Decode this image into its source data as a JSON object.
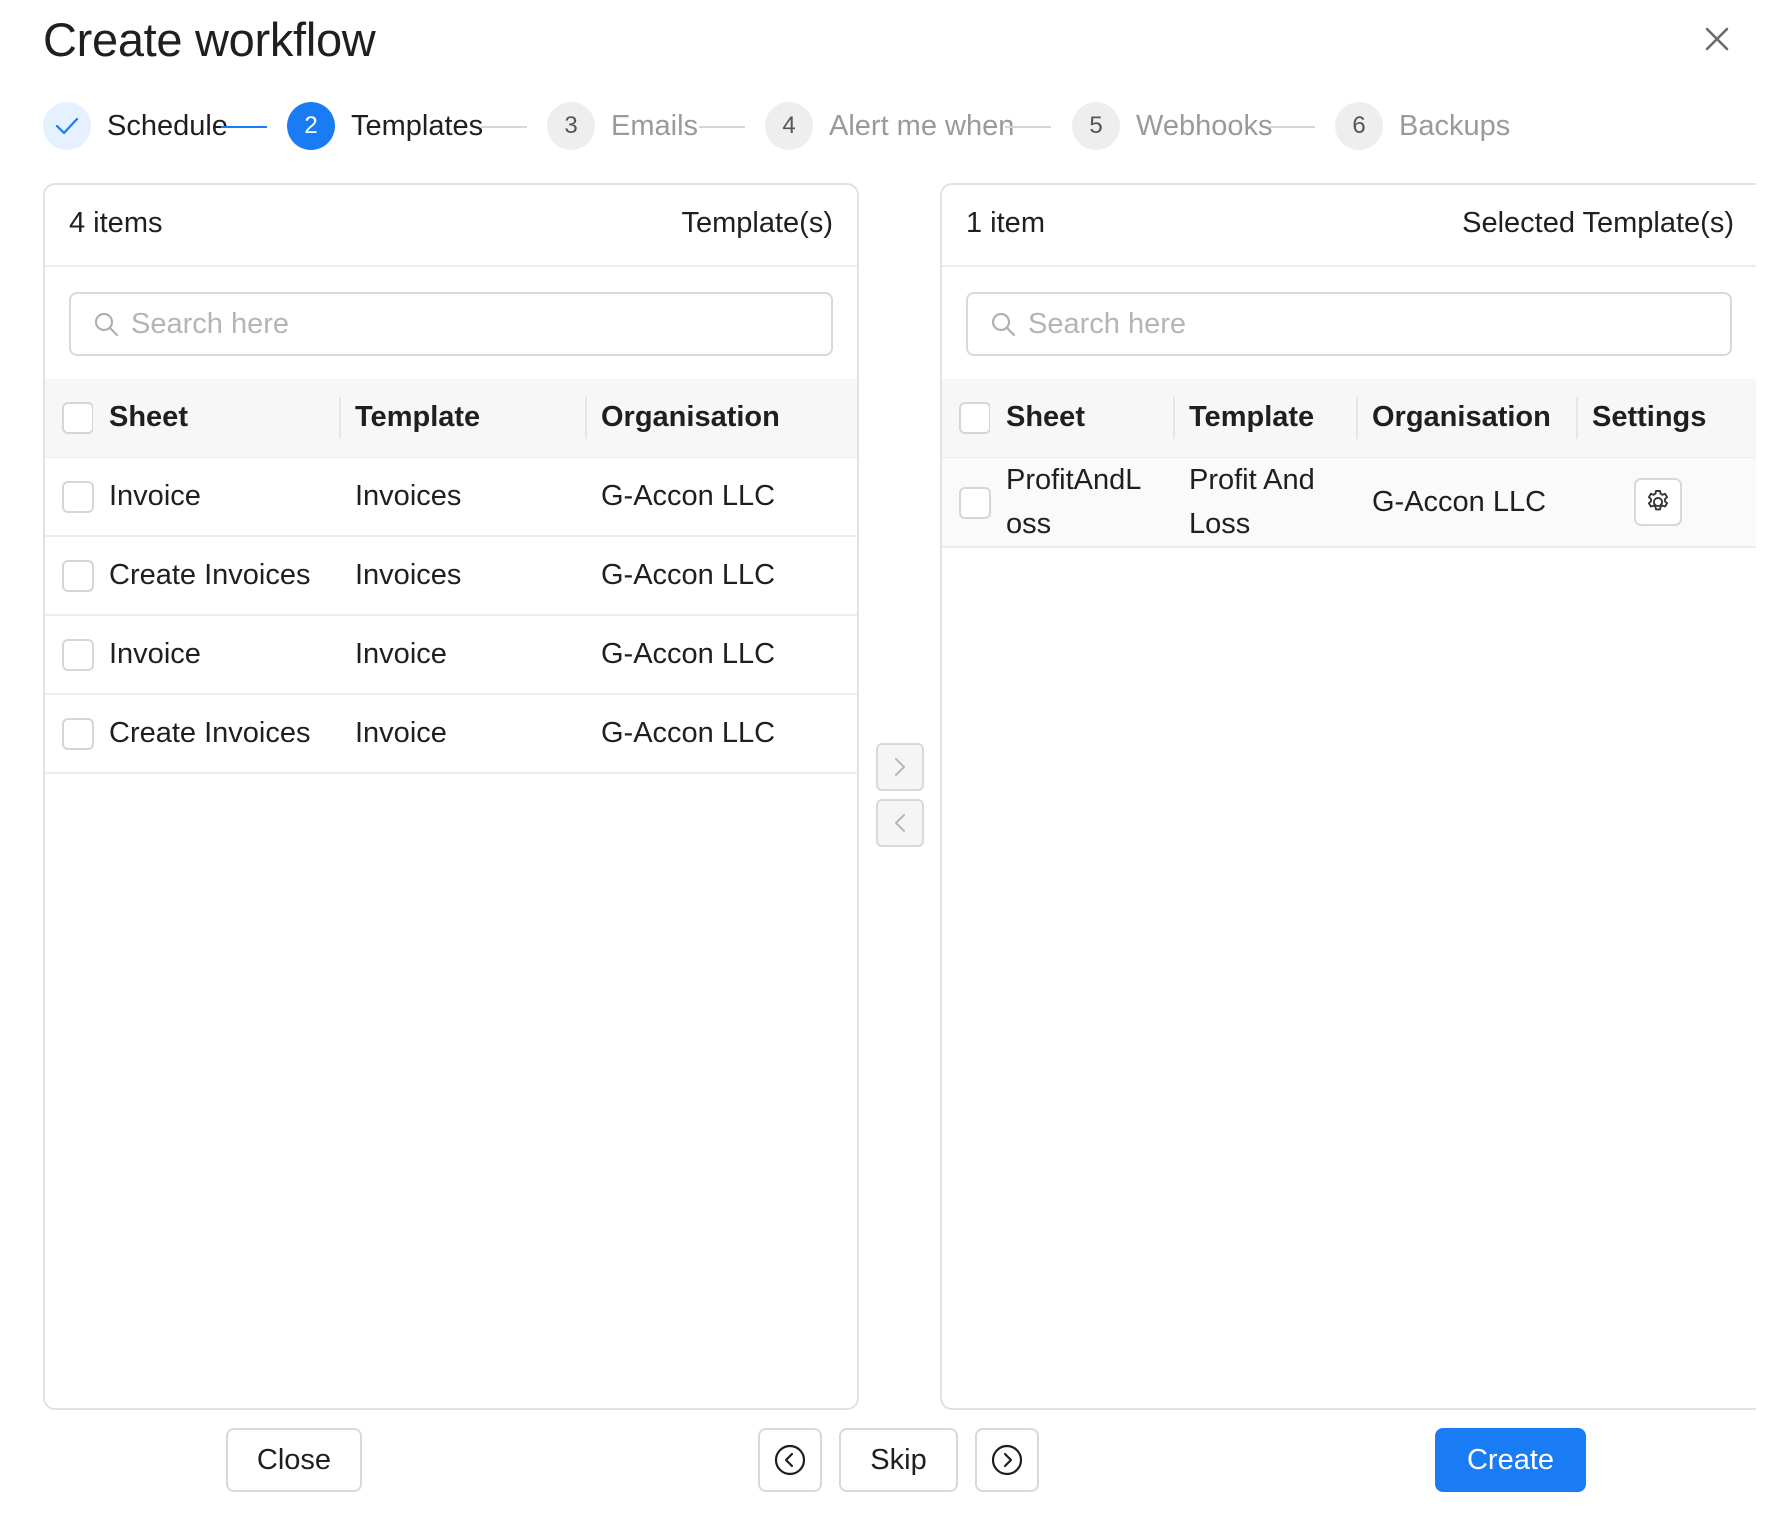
{
  "dialog": {
    "title": "Create workflow",
    "accent_color": "#1a7cf5"
  },
  "steps": [
    {
      "number": "1",
      "label": "Schedule",
      "state": "done"
    },
    {
      "number": "2",
      "label": "Templates",
      "state": "active"
    },
    {
      "number": "3",
      "label": "Emails",
      "state": "pending"
    },
    {
      "number": "4",
      "label": "Alert me when",
      "state": "pending"
    },
    {
      "number": "5",
      "label": "Webhooks",
      "state": "pending"
    },
    {
      "number": "6",
      "label": "Backups",
      "state": "pending"
    }
  ],
  "left_panel": {
    "count": "4 items",
    "title": "Template(s)",
    "search_placeholder": "Search here",
    "columns": [
      "Sheet",
      "Template",
      "Organisation"
    ],
    "rows": [
      {
        "sheet": "Invoice",
        "template": "Invoices",
        "organisation": "G-Accon LLC"
      },
      {
        "sheet": "Create Invoices",
        "template": "Invoices",
        "organisation": "G-Accon LLC"
      },
      {
        "sheet": "Invoice",
        "template": "Invoice",
        "organisation": "G-Accon LLC"
      },
      {
        "sheet": "Create Invoices",
        "template": "Invoice",
        "organisation": "G-Accon LLC"
      }
    ]
  },
  "right_panel": {
    "count": "1 item",
    "title": "Selected Template(s)",
    "search_placeholder": "Search here",
    "columns": [
      "Sheet",
      "Template",
      "Organisation",
      "Settings"
    ],
    "rows": [
      {
        "sheet": "ProfitAndL\noss",
        "template": "Profit And\nLoss",
        "organisation": "G-Accon LLC",
        "settings_icon": "gear-icon"
      }
    ]
  },
  "transfer": {
    "move_right_icon": "chevron-right-icon",
    "move_left_icon": "chevron-left-icon"
  },
  "footer": {
    "close_label": "Close",
    "prev_icon": "circle-chevron-left-icon",
    "skip_label": "Skip",
    "next_icon": "circle-chevron-right-icon",
    "create_label": "Create"
  }
}
